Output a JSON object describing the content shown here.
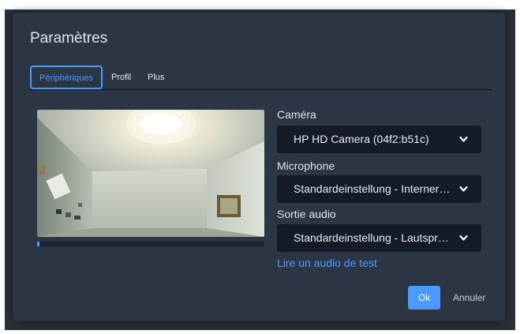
{
  "dialog": {
    "title": "Paramètres",
    "tabs": [
      {
        "label": "Périphériques",
        "active": true
      },
      {
        "label": "Profil",
        "active": false
      },
      {
        "label": "Plus",
        "active": false
      }
    ]
  },
  "devices": {
    "camera": {
      "label": "Caméra",
      "value": "HP HD Camera (04f2:b51c)"
    },
    "microphone": {
      "label": "Microphone",
      "value": "Standardeinstellung - Interner Mikrofonarray"
    },
    "audio_output": {
      "label": "Sortie audio",
      "value": "Standardeinstellung - Lautsprecher"
    },
    "test_audio_link": "Lire un audio de test",
    "mic_level": 0.01
  },
  "actions": {
    "ok": "Ok",
    "cancel": "Annuler"
  },
  "colors": {
    "accent": "#4c9aff",
    "dialog_bg": "#2c3544",
    "select_bg": "#141a26"
  },
  "icons": {
    "select_chevron": "chevron-down-icon"
  }
}
